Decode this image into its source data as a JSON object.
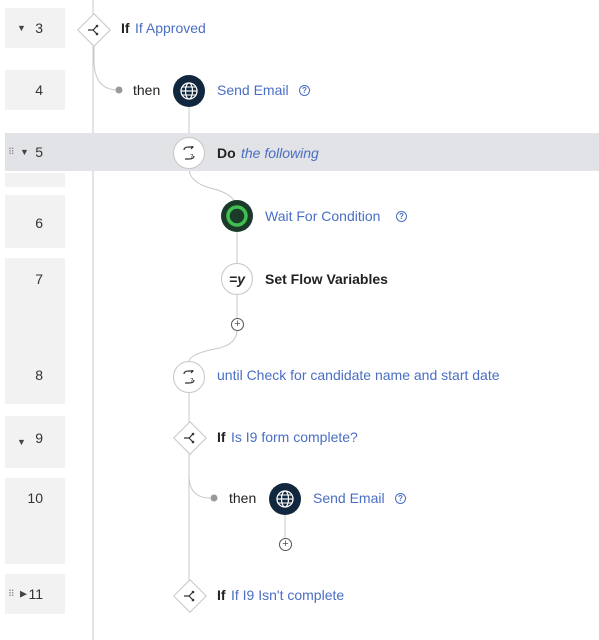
{
  "rows": [
    {
      "num": "3",
      "toggle": "▼"
    },
    {
      "num": "4"
    },
    {
      "num": "5",
      "toggle": "▼",
      "grip": "⠿"
    },
    {
      "num": "6"
    },
    {
      "num": "7"
    },
    {
      "num": "8"
    },
    {
      "num": "9",
      "toggle": "▼"
    },
    {
      "num": "10"
    },
    {
      "num": "11",
      "toggle": "▶",
      "grip": "⠿"
    }
  ],
  "steps": {
    "if1": {
      "keyword": "If",
      "condition": "If Approved"
    },
    "then1": {
      "label": "then"
    },
    "email1": {
      "label": "Send Email",
      "help": "?"
    },
    "do": {
      "keyword": "Do",
      "text": "the following"
    },
    "wait": {
      "label": "Wait For Condition",
      "help": "?"
    },
    "setvars": {
      "label": "Set Flow Variables",
      "icon_text": "=y"
    },
    "until": {
      "label": "until Check for candidate name and start date"
    },
    "if2": {
      "keyword": "If",
      "condition": "Is I9 form complete?"
    },
    "then2": {
      "label": "then"
    },
    "email2": {
      "label": "Send Email",
      "help": "?"
    },
    "if3": {
      "keyword": "If",
      "condition": "If I9 Isn't complete"
    }
  },
  "add_symbol": "+",
  "colors": {
    "link": "#4a6ec4",
    "node_dark": "#10273d",
    "highlight": "#e1e3e6",
    "wait_green": "#3fbf4f"
  }
}
